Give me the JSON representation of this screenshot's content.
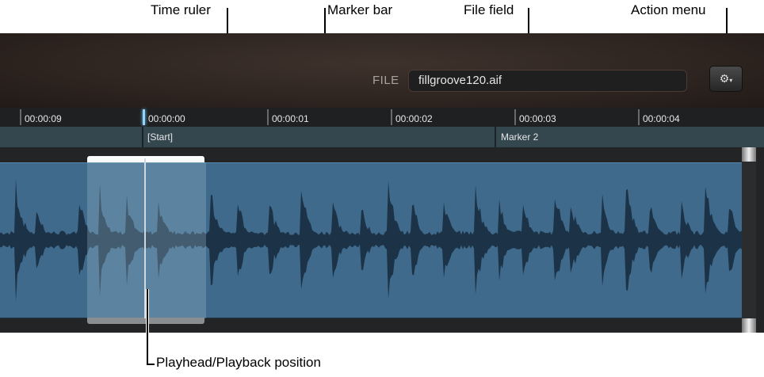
{
  "callouts": {
    "time_ruler": "Time ruler",
    "marker_bar": "Marker bar",
    "file_field": "File field",
    "action_menu": "Action menu",
    "playhead": "Playhead/Playback position"
  },
  "header": {
    "file_label": "FILE",
    "file_value": "fillgroove120.aif",
    "action_icon": "gear-icon"
  },
  "ruler": {
    "ticks": [
      "00:00:09",
      "00:00:00",
      "00:00:01",
      "00:00:02",
      "00:00:03",
      "00:00:04"
    ]
  },
  "markers": [
    "[Start]",
    "Marker 2"
  ],
  "colors": {
    "waveform_bg": "#3f6a8c",
    "waveform": "#1c3347",
    "playhead": "#7fd0ff"
  }
}
